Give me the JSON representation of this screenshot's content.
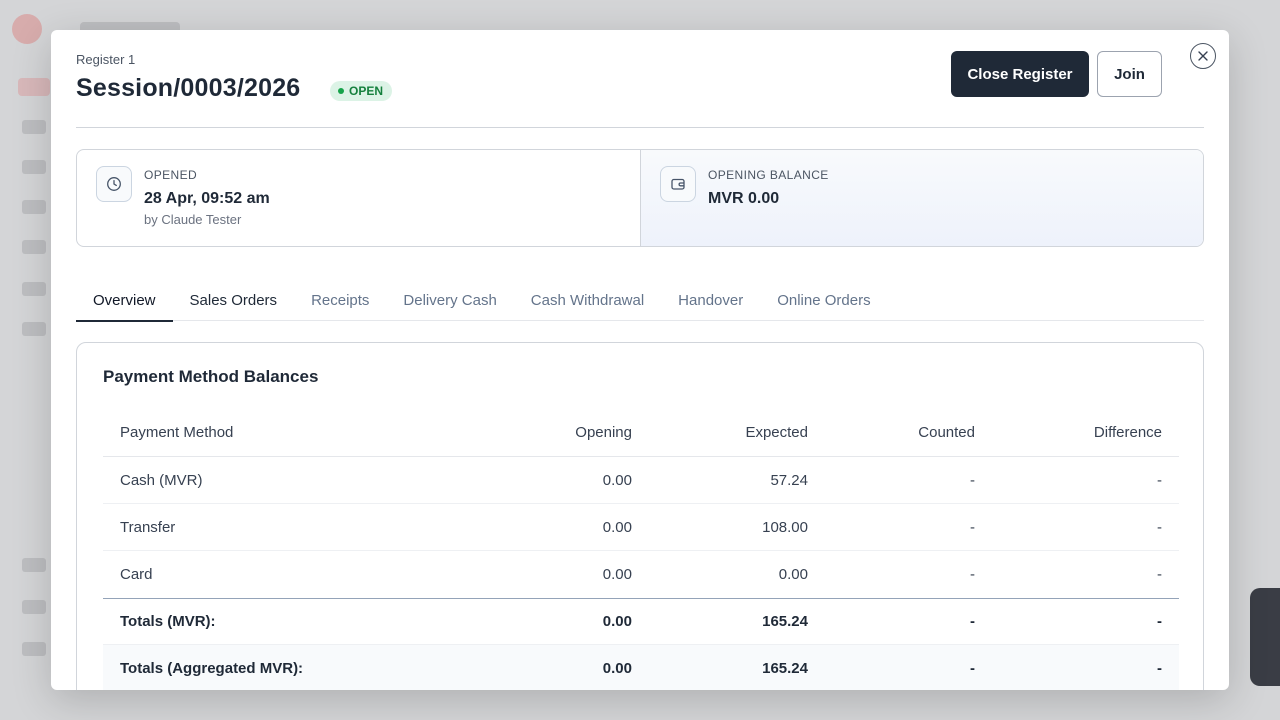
{
  "modal": {
    "register_label": "Register 1",
    "session_title": "Session/0003/2026",
    "status": "OPEN",
    "buttons": {
      "close_register": "Close Register",
      "join": "Join"
    },
    "close_icon": "close-icon"
  },
  "info": {
    "opened": {
      "label": "OPENED",
      "value": "28 Apr, 09:52 am",
      "sub": "by Claude Tester",
      "icon": "clock-icon"
    },
    "opening_balance": {
      "label": "OPENING BALANCE",
      "value": "MVR 0.00",
      "icon": "wallet-icon"
    }
  },
  "tabs": [
    {
      "label": "Overview"
    },
    {
      "label": "Sales Orders"
    },
    {
      "label": "Receipts"
    },
    {
      "label": "Delivery Cash"
    },
    {
      "label": "Cash Withdrawal"
    },
    {
      "label": "Handover"
    },
    {
      "label": "Online Orders"
    }
  ],
  "balances": {
    "title": "Payment Method Balances",
    "columns": [
      "Payment Method",
      "Opening",
      "Expected",
      "Counted",
      "Difference"
    ],
    "rows": [
      [
        "Cash (MVR)",
        "0.00",
        "57.24",
        "-",
        "-"
      ],
      [
        "Transfer",
        "0.00",
        "108.00",
        "-",
        "-"
      ],
      [
        "Card",
        "0.00",
        "0.00",
        "-",
        "-"
      ]
    ],
    "totals": [
      [
        "Totals (MVR):",
        "0.00",
        "165.24",
        "-",
        "-"
      ],
      [
        "Totals (Aggregated MVR):",
        "0.00",
        "165.24",
        "-",
        "-"
      ]
    ]
  },
  "colors": {
    "primary_button": "#1f2937",
    "status_bg": "#dcf3e6",
    "status_text": "#15803d"
  }
}
